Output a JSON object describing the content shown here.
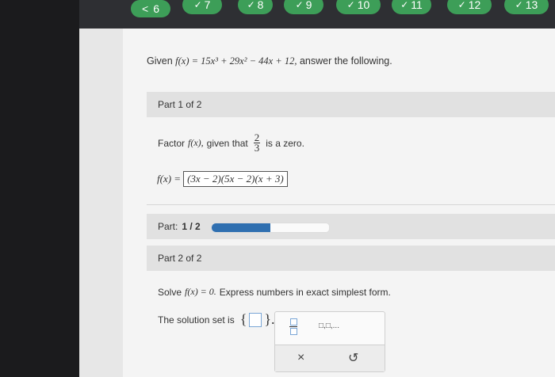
{
  "nav": {
    "back": "<",
    "questions": [
      {
        "label": "6",
        "done": true
      },
      {
        "label": "7",
        "done": true
      },
      {
        "label": "8",
        "done": true
      },
      {
        "label": "9",
        "done": true
      },
      {
        "label": "10",
        "done": true
      },
      {
        "label": "11",
        "done": true
      },
      {
        "label": "12",
        "done": true
      },
      {
        "label": "13",
        "done": true
      }
    ],
    "check": "✓"
  },
  "prompt": {
    "lead": "Given",
    "function": "f(x) = 15x³ + 29x² − 44x + 12,",
    "tail": "answer the following."
  },
  "part1": {
    "header": "Part 1 of 2",
    "instruction_lead": "Factor",
    "instruction_func": "f(x),",
    "instruction_mid": "given that",
    "zero_num": "2",
    "zero_den": "3",
    "instruction_tail": "is a zero.",
    "answer_lhs": "f(x) =",
    "answer_value": "(3x − 2)(5x − 2)(x + 3)"
  },
  "progress": {
    "label_lead": "Part:",
    "label_value": "1 / 2",
    "fraction": 0.5
  },
  "part2": {
    "header": "Part 2 of 2",
    "instruction_lead": "Solve",
    "instruction_eq": "f(x) = 0.",
    "instruction_tail": "Express numbers in exact simplest form.",
    "solution_label": "The solution set is",
    "set_open": "{",
    "set_close": "}."
  },
  "tools": {
    "fraction_icon": "fraction-template-icon",
    "list_icon": "list-template-icon",
    "list_text": "□,□,...",
    "clear": "×",
    "undo": "↺"
  },
  "colors": {
    "green": "#3d9e58",
    "blue": "#2f6fb0"
  }
}
